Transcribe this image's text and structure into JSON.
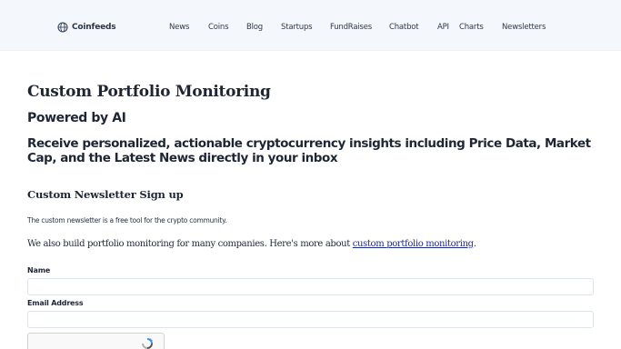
{
  "nav": {
    "brand": "Coinfeeds",
    "items": [
      "News",
      "Coins",
      "Blog",
      "Startups",
      "FundRaises",
      "Chatbot",
      "API",
      "Charts",
      "Newsletters"
    ]
  },
  "page": {
    "title": "Custom Portfolio Monitoring",
    "subtitle": "Powered by AI",
    "tagline": "Receive personalized, actionable cryptocurrency insights including Price Data, Market Cap, and the Latest News directly in your inbox"
  },
  "signup": {
    "heading": "Custom Newsletter Sign up",
    "note": "The custom newsletter is a free tool for the crypto community.",
    "portfolio_text": "We also build portfolio monitoring for many companies. Here's more about",
    "portfolio_link": "custom portfolio monitoring",
    "portfolio_suffix": ".",
    "name_label": "Name",
    "name_value": "",
    "email_label": "Email Address",
    "email_value": ""
  },
  "colors": {
    "nav_bg": "#f4f7fb",
    "link": "#1d2c8a",
    "text": "#1f2633"
  },
  "icons": {
    "brand_logo": "globe-icon",
    "captcha": "recaptcha-icon"
  }
}
